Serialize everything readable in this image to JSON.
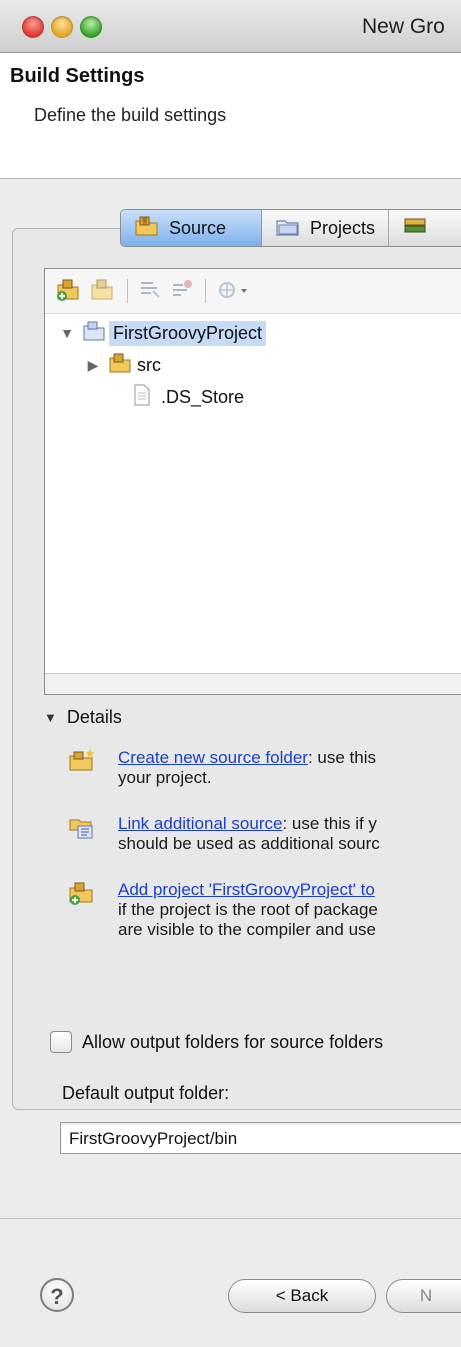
{
  "window": {
    "title": "New Gro"
  },
  "header": {
    "title": "Build Settings",
    "description": "Define the build settings"
  },
  "tabs": [
    {
      "label": "Source",
      "icon": "source-folder-icon",
      "active": true
    },
    {
      "label": "Projects",
      "icon": "projects-icon",
      "active": false
    },
    {
      "label": "",
      "icon": "libraries-icon",
      "active": false
    }
  ],
  "toolbar": {
    "items": [
      "add-folder-icon",
      "remove-folder-icon",
      "configure-icon",
      "link-icon",
      "filter-dropdown-icon"
    ]
  },
  "tree": {
    "items": [
      {
        "label": "FirstGroovyProject",
        "type": "project",
        "expanded": true,
        "selected": true
      },
      {
        "label": "src",
        "type": "source-folder",
        "expanded": false
      },
      {
        "label": ".DS_Store",
        "type": "file"
      }
    ]
  },
  "details": {
    "label": "Details",
    "items": [
      {
        "link": "Create new source folder",
        "rest": ": use this",
        "line2": "your project.",
        "line3": ""
      },
      {
        "link": "Link additional source",
        "rest": ": use this if y",
        "line2": "should be used as additional sourc",
        "line3": ""
      },
      {
        "link": "Add project 'FirstGroovyProject' to",
        "rest": "",
        "line2": "if the project is the root of package",
        "line3": "are visible to the compiler and use"
      }
    ]
  },
  "options": {
    "allow_output_label": "Allow output folders for source folders",
    "allow_output_checked": false,
    "default_output_label": "Default output folder:",
    "default_output_value": "FirstGroovyProject/bin"
  },
  "buttons": {
    "help": "?",
    "back": "< Back",
    "next": "N"
  }
}
